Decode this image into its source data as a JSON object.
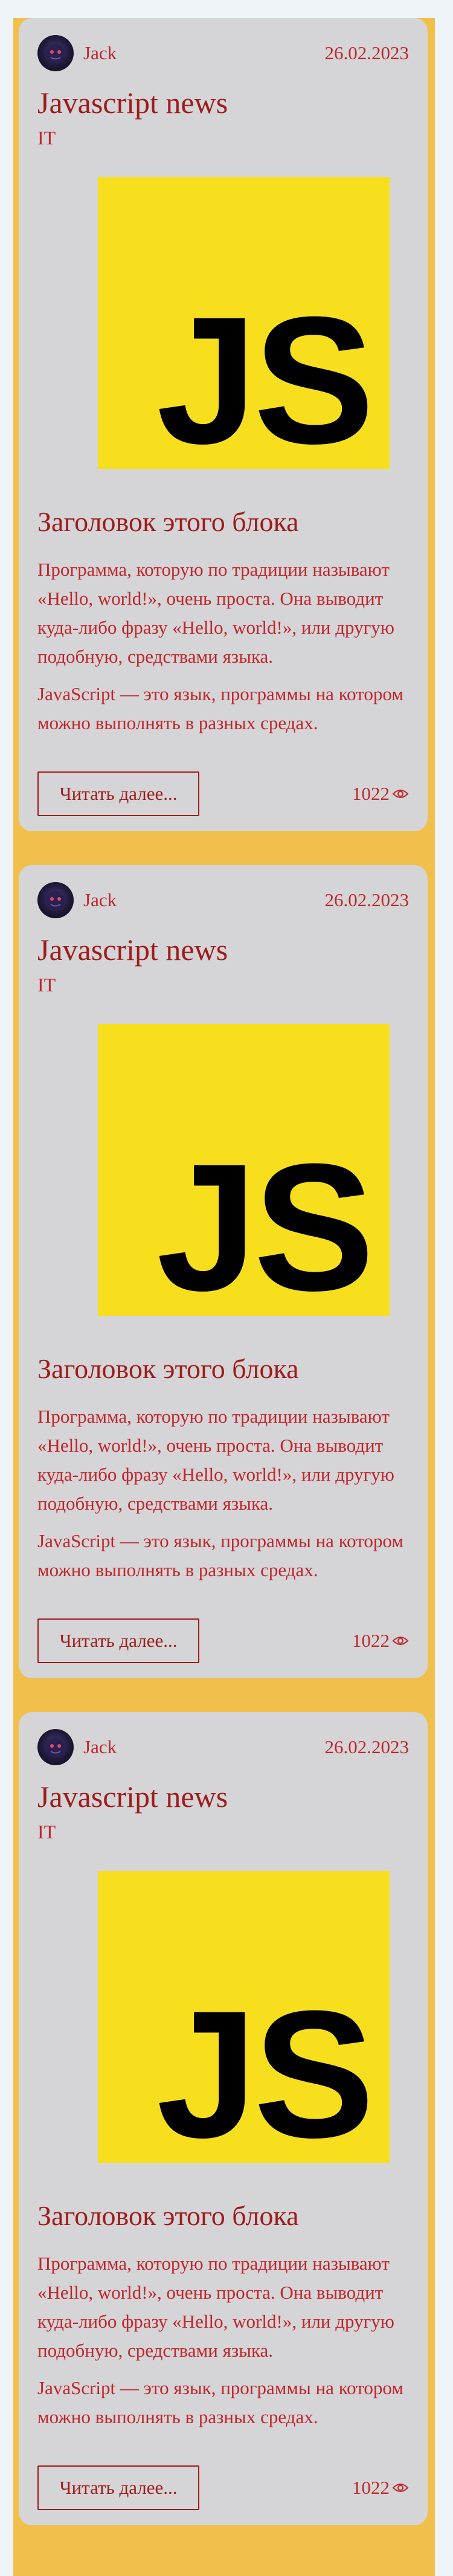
{
  "colors": {
    "page_background": "#eef4f7",
    "accent_strip": "#f1bf4b",
    "card_background": "#d5d5d7",
    "text_red": "#c0262c",
    "title_dark_red": "#9e1c1c",
    "js_logo_yellow": "#f7df1e",
    "js_logo_letters": "#000000"
  },
  "posts": [
    {
      "author": "Jack",
      "date": "26.02.2023",
      "title": "Javascript news",
      "category": "IT",
      "logo_text": "JS",
      "block_title": "Заголовок этого блока",
      "paragraph_1": "Программа, которую по традиции называют «Hello, world!», очень проста. Она выводит куда-либо фразу «Hello, world!», или другую подобную, средствами языка.",
      "paragraph_2": "JavaScript — это язык, программы на котором можно выполнять в разных средах.",
      "read_more_label": "Читать далее...",
      "views": "1022",
      "views_icon": "eye-icon"
    },
    {
      "author": "Jack",
      "date": "26.02.2023",
      "title": "Javascript news",
      "category": "IT",
      "logo_text": "JS",
      "block_title": "Заголовок этого блока",
      "paragraph_1": "Программа, которую по традиции называют «Hello, world!», очень проста. Она выводит куда-либо фразу «Hello, world!», или другую подобную, средствами языка.",
      "paragraph_2": "JavaScript — это язык, программы на котором можно выполнять в разных средах.",
      "read_more_label": "Читать далее...",
      "views": "1022",
      "views_icon": "eye-icon"
    },
    {
      "author": "Jack",
      "date": "26.02.2023",
      "title": "Javascript news",
      "category": "IT",
      "logo_text": "JS",
      "block_title": "Заголовок этого блока",
      "paragraph_1": "Программа, которую по традиции называют «Hello, world!», очень проста. Она выводит куда-либо фразу «Hello, world!», или другую подобную, средствами языка.",
      "paragraph_2": "JavaScript — это язык, программы на котором можно выполнять в разных средах.",
      "read_more_label": "Читать далее...",
      "views": "1022",
      "views_icon": "eye-icon"
    }
  ]
}
